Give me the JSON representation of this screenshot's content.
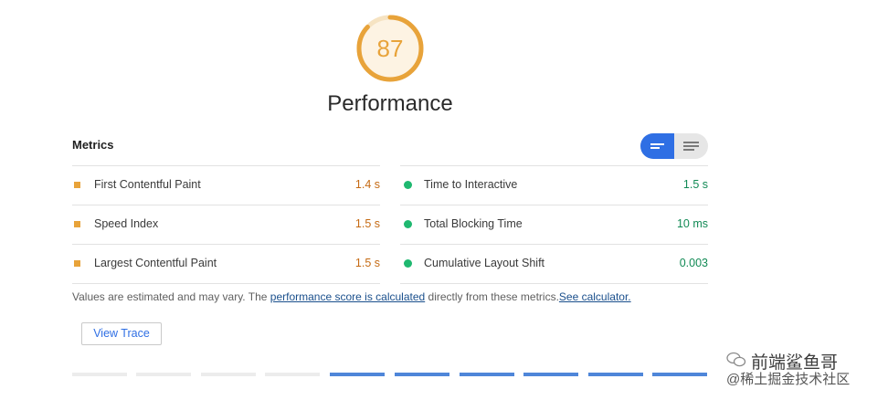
{
  "score": {
    "value": "87",
    "fraction": 0.87,
    "color": "#e8a33a"
  },
  "category_title": "Performance",
  "metrics": {
    "heading": "Metrics",
    "toggle": {
      "compact_icon": "lines-compact-icon",
      "expanded_icon": "lines-expanded-icon",
      "active": "compact"
    },
    "left": [
      {
        "label": "First Contentful Paint",
        "value": "1.4 s",
        "status": "average"
      },
      {
        "label": "Speed Index",
        "value": "1.5 s",
        "status": "average"
      },
      {
        "label": "Largest Contentful Paint",
        "value": "1.5 s",
        "status": "average"
      }
    ],
    "right": [
      {
        "label": "Time to Interactive",
        "value": "1.5 s",
        "status": "pass"
      },
      {
        "label": "Total Blocking Time",
        "value": "10 ms",
        "status": "pass"
      },
      {
        "label": "Cumulative Layout Shift",
        "value": "0.003",
        "status": "pass"
      }
    ]
  },
  "footnote": {
    "text_before": "Values are estimated and may vary. The ",
    "link1": "performance score is calculated",
    "text_middle": " directly from these metrics.",
    "link2": "See calculator."
  },
  "view_trace_label": "View Trace",
  "watermark": {
    "line1": "前端鲨鱼哥",
    "line2": "@稀土掘金技术社区"
  },
  "colors": {
    "average": "#e8a33a",
    "pass": "#1fb870",
    "accent": "#2f6fe4"
  }
}
